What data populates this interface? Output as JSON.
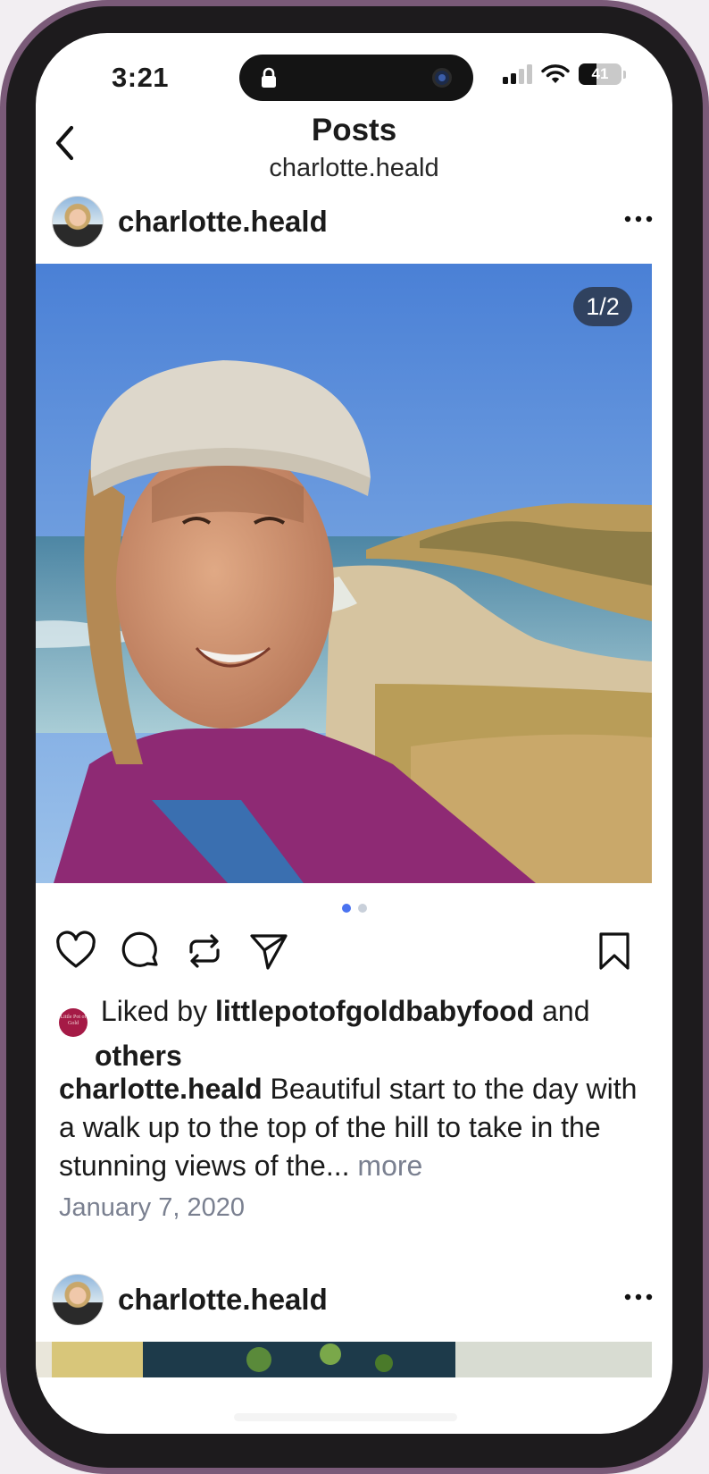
{
  "status_bar": {
    "time": "3:21",
    "battery": "41"
  },
  "header": {
    "title": "Posts",
    "subtitle": "charlotte.heald"
  },
  "post": {
    "username": "charlotte.heald",
    "carousel_counter": "1/2",
    "carousel_pages": 2,
    "carousel_active": 1,
    "likes": {
      "prefix": "Liked by",
      "liker": "littlepotofgoldbabyfood",
      "conjunction": "and",
      "others": "others",
      "liker_avatar_text": "Little Pot of Gold"
    },
    "caption": {
      "username": "charlotte.heald",
      "text": "Beautiful start to the day with a walk up to the top of the hill to take in the stunning views of the...",
      "more": "more"
    },
    "date": "January 7, 2020"
  },
  "next_post": {
    "username": "charlotte.heald"
  },
  "icons": {
    "back": "chevron-left-icon",
    "more": "more-horizontal-icon",
    "like": "heart-icon",
    "comment": "comment-icon",
    "repost": "repost-icon",
    "share": "send-icon",
    "save": "bookmark-icon"
  },
  "colors": {
    "active_dot": "#4a73f0",
    "liker_avatar": "#a51a46",
    "muted_text": "#7a8090"
  }
}
